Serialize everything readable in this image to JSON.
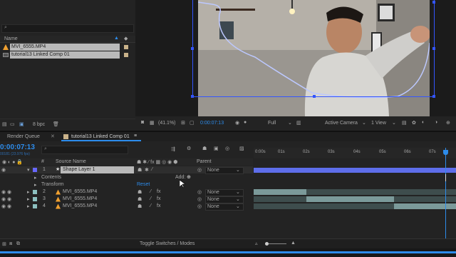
{
  "project": {
    "search_placeholder": "",
    "col_name": "Name",
    "items": [
      {
        "label": "MVI_6555.MP4",
        "type": "footage",
        "tag_color": "#c9b28a"
      },
      {
        "label": "tutorial13 Linked Comp 01",
        "type": "composition",
        "tag_color": "#c9b28a"
      }
    ],
    "bpc": "8 bpc"
  },
  "viewer": {
    "zoom": "(41.1%)",
    "timecode": "0:00:07:13",
    "resolution": "Full",
    "camera": "Active Camera",
    "views": "1 View"
  },
  "tabs": {
    "render_queue": "Render Queue",
    "comp": "tutorial13 Linked Comp 01"
  },
  "timeline": {
    "current_time": "0:00:07:13",
    "fps": "00181 (23.976 fps)",
    "col_num": "#",
    "col_source": "Source Name",
    "col_parent": "Parent",
    "ruler": [
      "0:00s",
      "01s",
      "02s",
      "03s",
      "04s",
      "05s",
      "06s",
      "07s"
    ],
    "layers": [
      {
        "num": "1",
        "name": "Shape Layer 1",
        "parent": "None",
        "color": "#6868ff"
      },
      {
        "num": "2",
        "name": "MVI_6555.MP4",
        "parent": "None",
        "color": "#8cc0c0"
      },
      {
        "num": "3",
        "name": "MVI_6555.MP4",
        "parent": "None",
        "color": "#8cc0c0"
      },
      {
        "num": "4",
        "name": "MVI_6555.MP4",
        "parent": "None",
        "color": "#8cc0c0"
      }
    ],
    "contents_label": "Contents",
    "add_label": "Add:",
    "transform_label": "Transform",
    "reset_label": "Reset",
    "toggle_label": "Toggle Switches / Modes"
  }
}
